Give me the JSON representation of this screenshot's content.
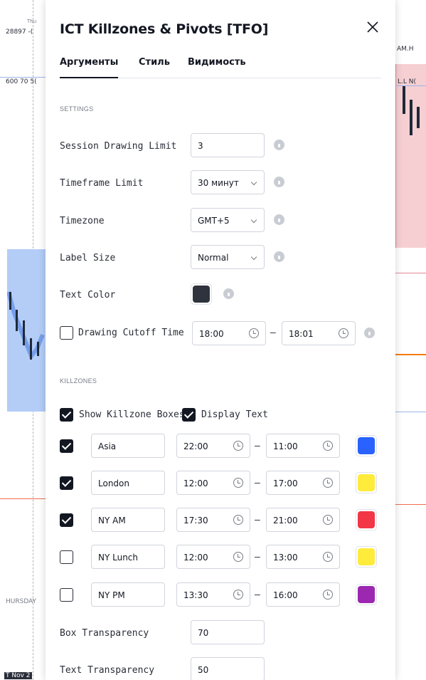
{
  "background": {
    "top_left_value": "28897 -(",
    "top_left_small": "Thu",
    "left_price_box": "600 70 5(",
    "right_top_label": "AM.H",
    "right_box_label": "L.L N(",
    "thursday_label": "HURSDAY",
    "bottom_left_label": "T Nov 2"
  },
  "dialog": {
    "title": "ICT Killzones & Pivots [TFO]",
    "tabs": [
      "Аргументы",
      "Стиль",
      "Видимость"
    ],
    "settings_header": "SETTINGS",
    "settings": {
      "session_limit_label": "Session Drawing Limit",
      "session_limit_value": "3",
      "timeframe_label": "Timeframe Limit",
      "timeframe_value": "30 минут",
      "timezone_label": "Timezone",
      "timezone_value": "GMT+5",
      "label_size_label": "Label Size",
      "label_size_value": "Normal",
      "text_color_label": "Text Color",
      "text_color": "#2f333d",
      "cutoff_label": "Drawing Cutoff Time",
      "cutoff_checked": false,
      "cutoff_start": "18:00",
      "cutoff_end": "18:01"
    },
    "killzones_header": "KILLZONES",
    "show_boxes_label": "Show Killzone Boxes",
    "show_boxes_checked": true,
    "display_text_label": "Display Text",
    "display_text_checked": true,
    "zones": [
      {
        "name": "Asia",
        "checked": true,
        "start": "22:00",
        "end": "11:00",
        "color": "#2962ff"
      },
      {
        "name": "London",
        "checked": true,
        "start": "12:00",
        "end": "17:00",
        "color": "#ffeb3b"
      },
      {
        "name": "NY AM",
        "checked": true,
        "start": "17:30",
        "end": "21:00",
        "color": "#f23645"
      },
      {
        "name": "NY Lunch",
        "checked": false,
        "start": "12:00",
        "end": "13:00",
        "color": "#ffeb3b"
      },
      {
        "name": "NY PM",
        "checked": false,
        "start": "13:30",
        "end": "16:00",
        "color": "#9c27b0"
      }
    ],
    "box_transparency_label": "Box Transparency",
    "box_transparency_value": "70",
    "text_transparency_label": "Text Transparency",
    "text_transparency_value": "50",
    "dash": "–"
  }
}
